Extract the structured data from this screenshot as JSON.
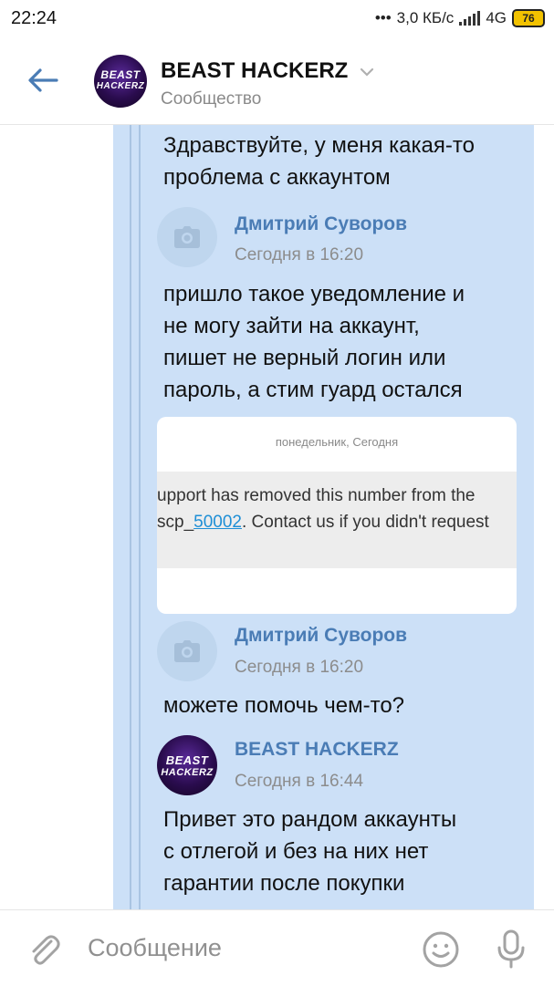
{
  "status_bar": {
    "time": "22:24",
    "dots": "•••",
    "network_speed": "3,0 КБ/с",
    "network_type": "4G",
    "battery": "76"
  },
  "header": {
    "title": "BEAST HACKERZ",
    "subtitle": "Сообщество",
    "avatar_text": [
      "BEAST",
      "HACKERZ"
    ]
  },
  "thread": {
    "first_message_lines": [
      "Здравствуйте, у меня какая-то",
      "проблема с аккаунтом"
    ],
    "messages": [
      {
        "author": "Дмитрий Суворов",
        "time": "Сегодня в 16:20",
        "lines": [
          "пришло такое уведомление и",
          "не могу зайти на аккаунт,",
          "пишет не верный логин или",
          "пароль, а стим гуард остался"
        ]
      },
      {
        "author": "Дмитрий Суворов",
        "time": "Сегодня в 16:20",
        "lines": [
          "можете помочь чем-то?"
        ]
      },
      {
        "author": "BEAST HACKERZ",
        "time": "Сегодня в 16:44",
        "lines": [
          "Привет это рандом аккаунты",
          "с отлегой и без на них нет",
          "гарантии после покупки"
        ]
      }
    ],
    "attachment": {
      "date_label": "понедельник, Сегодня",
      "line1": "upport has removed this number from the",
      "line2_prefix": "scp_",
      "line2_link": "50002",
      "line2_suffix": ". Contact us if you didn't request"
    }
  },
  "input": {
    "placeholder": "Сообщение"
  },
  "colors": {
    "accent": "#4a7cb5",
    "thread_bg": "#cce0f7",
    "link": "#1e8fd6"
  }
}
